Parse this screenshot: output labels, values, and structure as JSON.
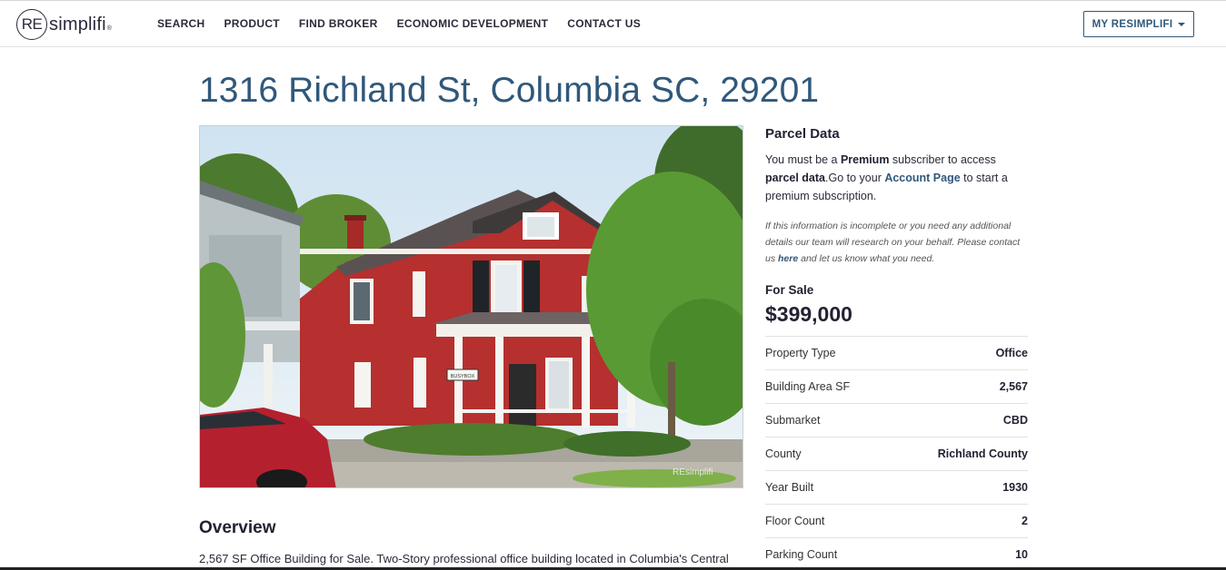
{
  "logo": {
    "mark": "RE",
    "name": "simplifi",
    "tm": "®"
  },
  "nav": {
    "items": [
      "SEARCH",
      "PRODUCT",
      "FIND BROKER",
      "ECONOMIC DEVELOPMENT",
      "CONTACT US"
    ],
    "account_button": "MY RESIMPLIFI"
  },
  "page": {
    "title": "1316 Richland St, Columbia SC, 29201",
    "photo_watermark": "REsimplifi",
    "photo_sign": "BUSYBOX"
  },
  "overview": {
    "heading": "Overview",
    "text": "2,567 SF Office Building for Sale. Two-Story professional office building located in Columbia's Central"
  },
  "parcel": {
    "heading": "Parcel Data",
    "p1": "You must be a ",
    "premium": "Premium",
    "p2": " subscriber to access ",
    "parcel_data": "parcel data",
    "p3": ".Go to your ",
    "account_page": "Account Page",
    "p4": " to start a premium subscription.",
    "note1": "If this information is incomplete or you need any additional details our team will research on your behalf. Please contact us ",
    "note_here": "here",
    "note2": " and let us know what you need."
  },
  "sale": {
    "heading": "For Sale",
    "price": "$399,000"
  },
  "properties": [
    {
      "label": "Property Type",
      "value": "Office"
    },
    {
      "label": "Building Area SF",
      "value": "2,567"
    },
    {
      "label": "Submarket",
      "value": "CBD"
    },
    {
      "label": "County",
      "value": "Richland County"
    },
    {
      "label": "Year Built",
      "value": "1930"
    },
    {
      "label": "Floor Count",
      "value": "2"
    },
    {
      "label": "Parking Count",
      "value": "10"
    }
  ],
  "colors": {
    "accent": "#30587a",
    "text": "#222233",
    "house_red": "#b5302f"
  }
}
